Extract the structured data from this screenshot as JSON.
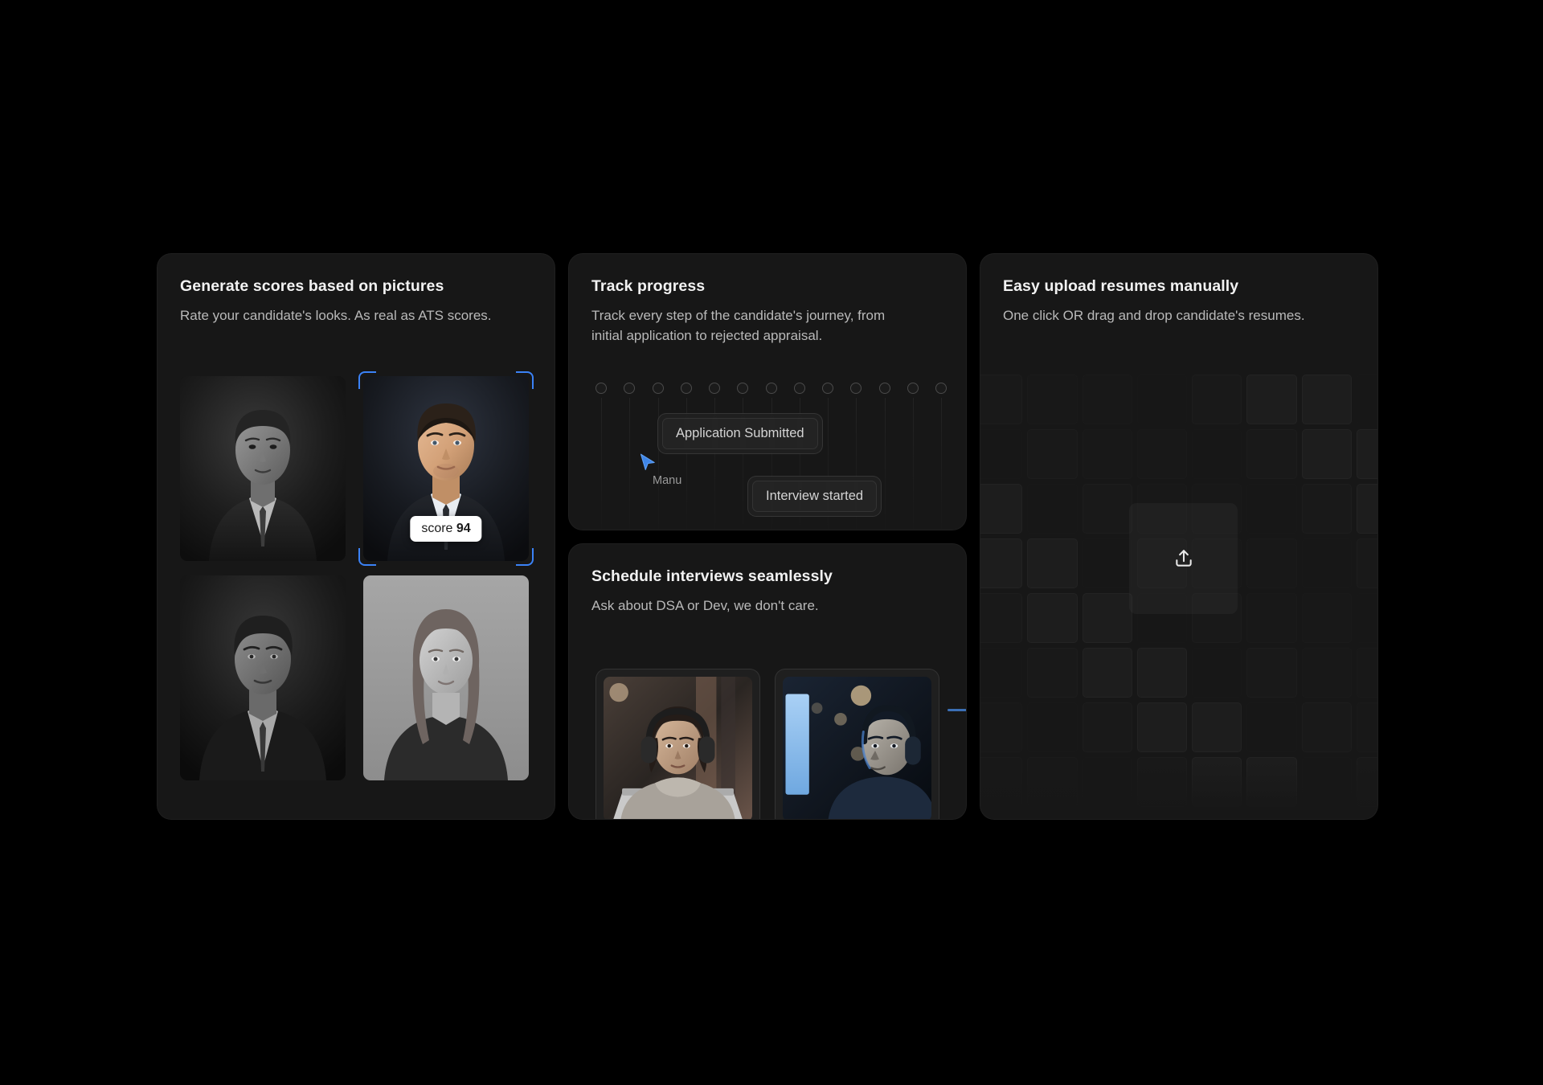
{
  "theme": {
    "page_background": "#000000",
    "card_background": "#171717",
    "accent_blue": "#3b82f6",
    "title_color": "#f2f2f2",
    "subtitle_color": "#b9b9b9"
  },
  "cards": {
    "scores": {
      "title": "Generate scores based on pictures",
      "subtitle": "Rate your candidate's looks. As real as ATS scores.",
      "photos": [
        {
          "id": "candidate-1",
          "selected": false,
          "grayscale": true
        },
        {
          "id": "candidate-2",
          "selected": true,
          "grayscale": false
        },
        {
          "id": "candidate-3",
          "selected": false,
          "grayscale": true
        },
        {
          "id": "candidate-4",
          "selected": false,
          "grayscale": true
        }
      ],
      "score_label": "score",
      "score_value": "94"
    },
    "track": {
      "title": "Track progress",
      "subtitle": "Track every step of the candidate's journey, from initial application to rejected appraisal.",
      "step_count": 13,
      "badges": [
        {
          "id": "application-submitted",
          "label": "Application Submitted"
        },
        {
          "id": "interview-started",
          "label": "Interview started"
        }
      ],
      "cursor": {
        "icon": "cursor-pointer-icon",
        "label": "Manu",
        "color": "#3b82f6"
      }
    },
    "schedule": {
      "title": "Schedule interviews seamlessly",
      "subtitle": "Ask about DSA or Dev, we don't care.",
      "calls": [
        {
          "id": "interviewee-tile",
          "tone": "warm"
        },
        {
          "id": "interviewer-tile",
          "tone": "blue"
        }
      ]
    },
    "upload": {
      "title": "Easy upload resumes manually",
      "subtitle": "One click OR drag and drop candidate's resumes.",
      "drop_zone": {
        "icon": "upload-icon"
      }
    }
  }
}
